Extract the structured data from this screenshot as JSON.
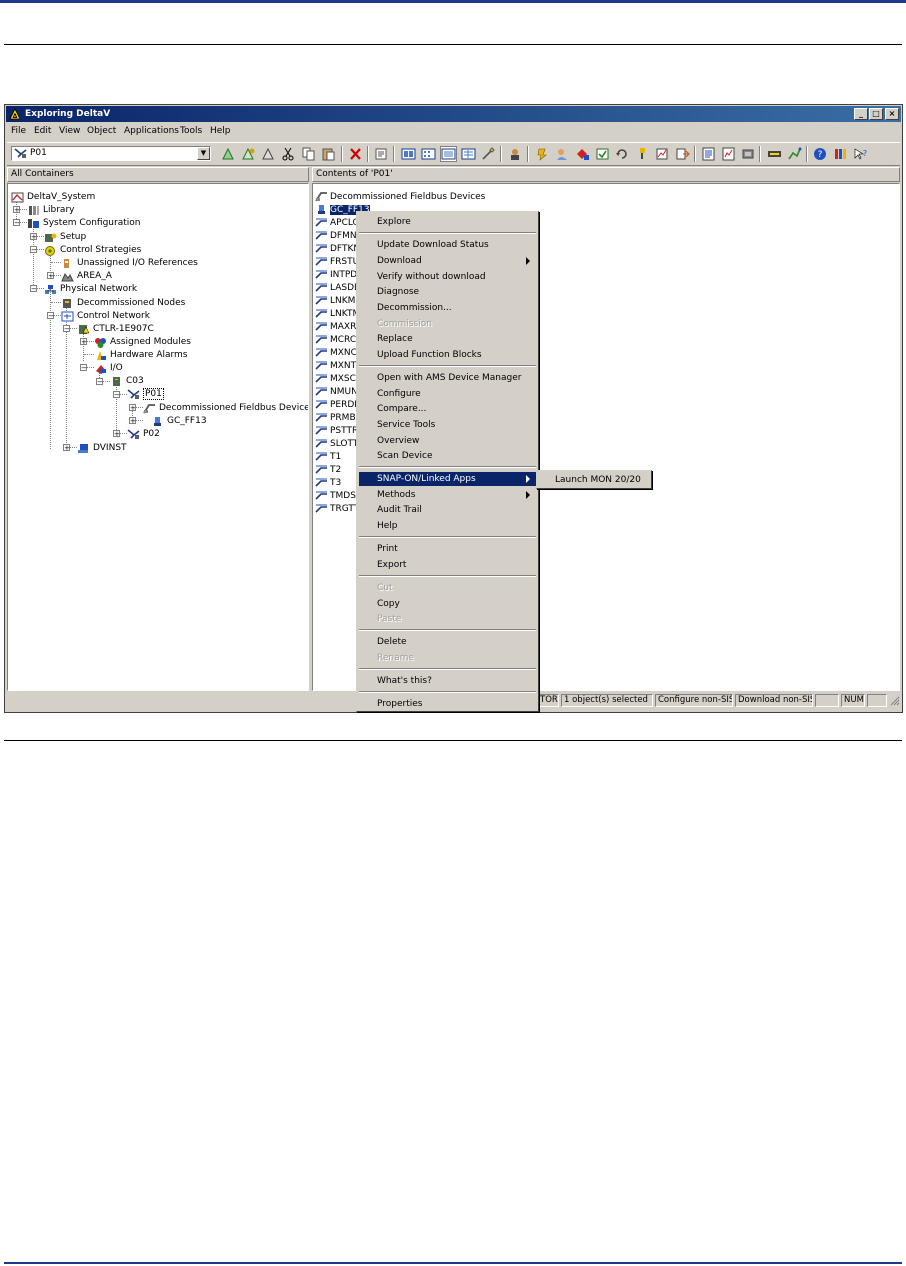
{
  "window": {
    "title": "Exploring DeltaV",
    "min": "_",
    "max": "□",
    "close": "×"
  },
  "menu": [
    "File",
    "Edit",
    "View",
    "Object",
    "Applications",
    "Tools",
    "Help"
  ],
  "toolbar": {
    "path_value": "P01",
    "dropdown_arrow": "▼"
  },
  "left_pane": {
    "header": "All Containers",
    "tree": [
      {
        "label": "DeltaV_System",
        "icon": "system-icon"
      },
      {
        "label": "Library",
        "icon": "library-icon",
        "expander": "+"
      },
      {
        "label": "System Configuration",
        "icon": "config-icon",
        "expander": "−"
      },
      {
        "label": "Setup",
        "icon": "setup-icon",
        "expander": "+"
      },
      {
        "label": "Control Strategies",
        "icon": "strategies-icon",
        "expander": "−"
      },
      {
        "label": "Unassigned I/O References",
        "icon": "io-ref-icon"
      },
      {
        "label": "AREA_A",
        "icon": "area-icon",
        "expander": "+"
      },
      {
        "label": "Physical Network",
        "icon": "network-icon",
        "expander": "−"
      },
      {
        "label": "Decommissioned Nodes",
        "icon": "decom-nodes-icon"
      },
      {
        "label": "Control Network",
        "icon": "control-network-icon",
        "expander": "−"
      },
      {
        "label": "CTLR-1E907C",
        "icon": "controller-icon",
        "expander": "−"
      },
      {
        "label": "Assigned Modules",
        "icon": "modules-icon",
        "expander": "+"
      },
      {
        "label": "Hardware Alarms",
        "icon": "alarm-icon"
      },
      {
        "label": "I/O",
        "icon": "io-icon",
        "expander": "−"
      },
      {
        "label": "C03",
        "icon": "card-icon",
        "expander": "−"
      },
      {
        "label": "P01",
        "icon": "port-icon",
        "expander": "−"
      },
      {
        "label": "Decommissioned Fieldbus Devices",
        "icon": "fieldbus-icon",
        "expander": "+"
      },
      {
        "label": "GC_FF13",
        "icon": "device-icon",
        "expander": "+"
      },
      {
        "label": "P02",
        "icon": "port-icon",
        "expander": "+"
      },
      {
        "label": "DVINST",
        "icon": "workstation-icon",
        "expander": "+"
      }
    ]
  },
  "right_pane": {
    "header": "Contents of 'P01'",
    "items": [
      "Decommissioned Fieldbus Devices",
      "GC_FF13",
      "APCLO",
      "DFMNT",
      "DFTKN",
      "FRSTUN",
      "INTPDU",
      "LASDB",
      "LNKMN",
      "LNKTM",
      "MAXRS",
      "MCRCY",
      "MXNCT",
      "MXNTR",
      "MXSCH",
      "NMUNR",
      "PERDLI",
      "PRMBL",
      "PSTTRI",
      "SLOTTI",
      "T1",
      "T2",
      "T3",
      "TMDST",
      "TRGTTI"
    ]
  },
  "context_menu": {
    "items": [
      {
        "label": "Explore"
      },
      {
        "sep": true
      },
      {
        "label": "Update Download Status"
      },
      {
        "label": "Download",
        "submenu": true
      },
      {
        "label": "Verify without download"
      },
      {
        "label": "Diagnose"
      },
      {
        "label": "Decommission..."
      },
      {
        "label": "Commission",
        "disabled": true
      },
      {
        "label": "Replace"
      },
      {
        "label": "Upload Function Blocks"
      },
      {
        "sep": true
      },
      {
        "label": "Open with AMS Device Manager"
      },
      {
        "label": "Configure"
      },
      {
        "label": "Compare..."
      },
      {
        "label": "Service Tools"
      },
      {
        "label": "Overview"
      },
      {
        "label": "Scan Device"
      },
      {
        "sep": true
      },
      {
        "label": "SNAP-ON/Linked Apps",
        "submenu": true,
        "active": true
      },
      {
        "label": "Methods",
        "submenu": true
      },
      {
        "label": "Audit Trail"
      },
      {
        "label": "Help"
      },
      {
        "sep": true
      },
      {
        "label": "Print"
      },
      {
        "label": "Export"
      },
      {
        "sep": true
      },
      {
        "label": "Cut",
        "disabled": true
      },
      {
        "label": "Copy"
      },
      {
        "label": "Paste",
        "disabled": true
      },
      {
        "sep": true
      },
      {
        "label": "Delete"
      },
      {
        "label": "Rename",
        "disabled": true
      },
      {
        "sep": true
      },
      {
        "label": "What's this?"
      },
      {
        "sep": true
      },
      {
        "label": "Properties"
      }
    ],
    "submenu_items": [
      "Launch MON 20/20"
    ]
  },
  "statusbar": [
    "TOR",
    "1 object(s) selected",
    "Configure non-SIS",
    "Download non-SIS",
    "",
    "NUM",
    "",
    ""
  ],
  "colors": {
    "title_bar": "#0a246a",
    "highlight": "#0a246a",
    "chrome": "#d4d0c8",
    "rule": "#1c3a8a"
  }
}
